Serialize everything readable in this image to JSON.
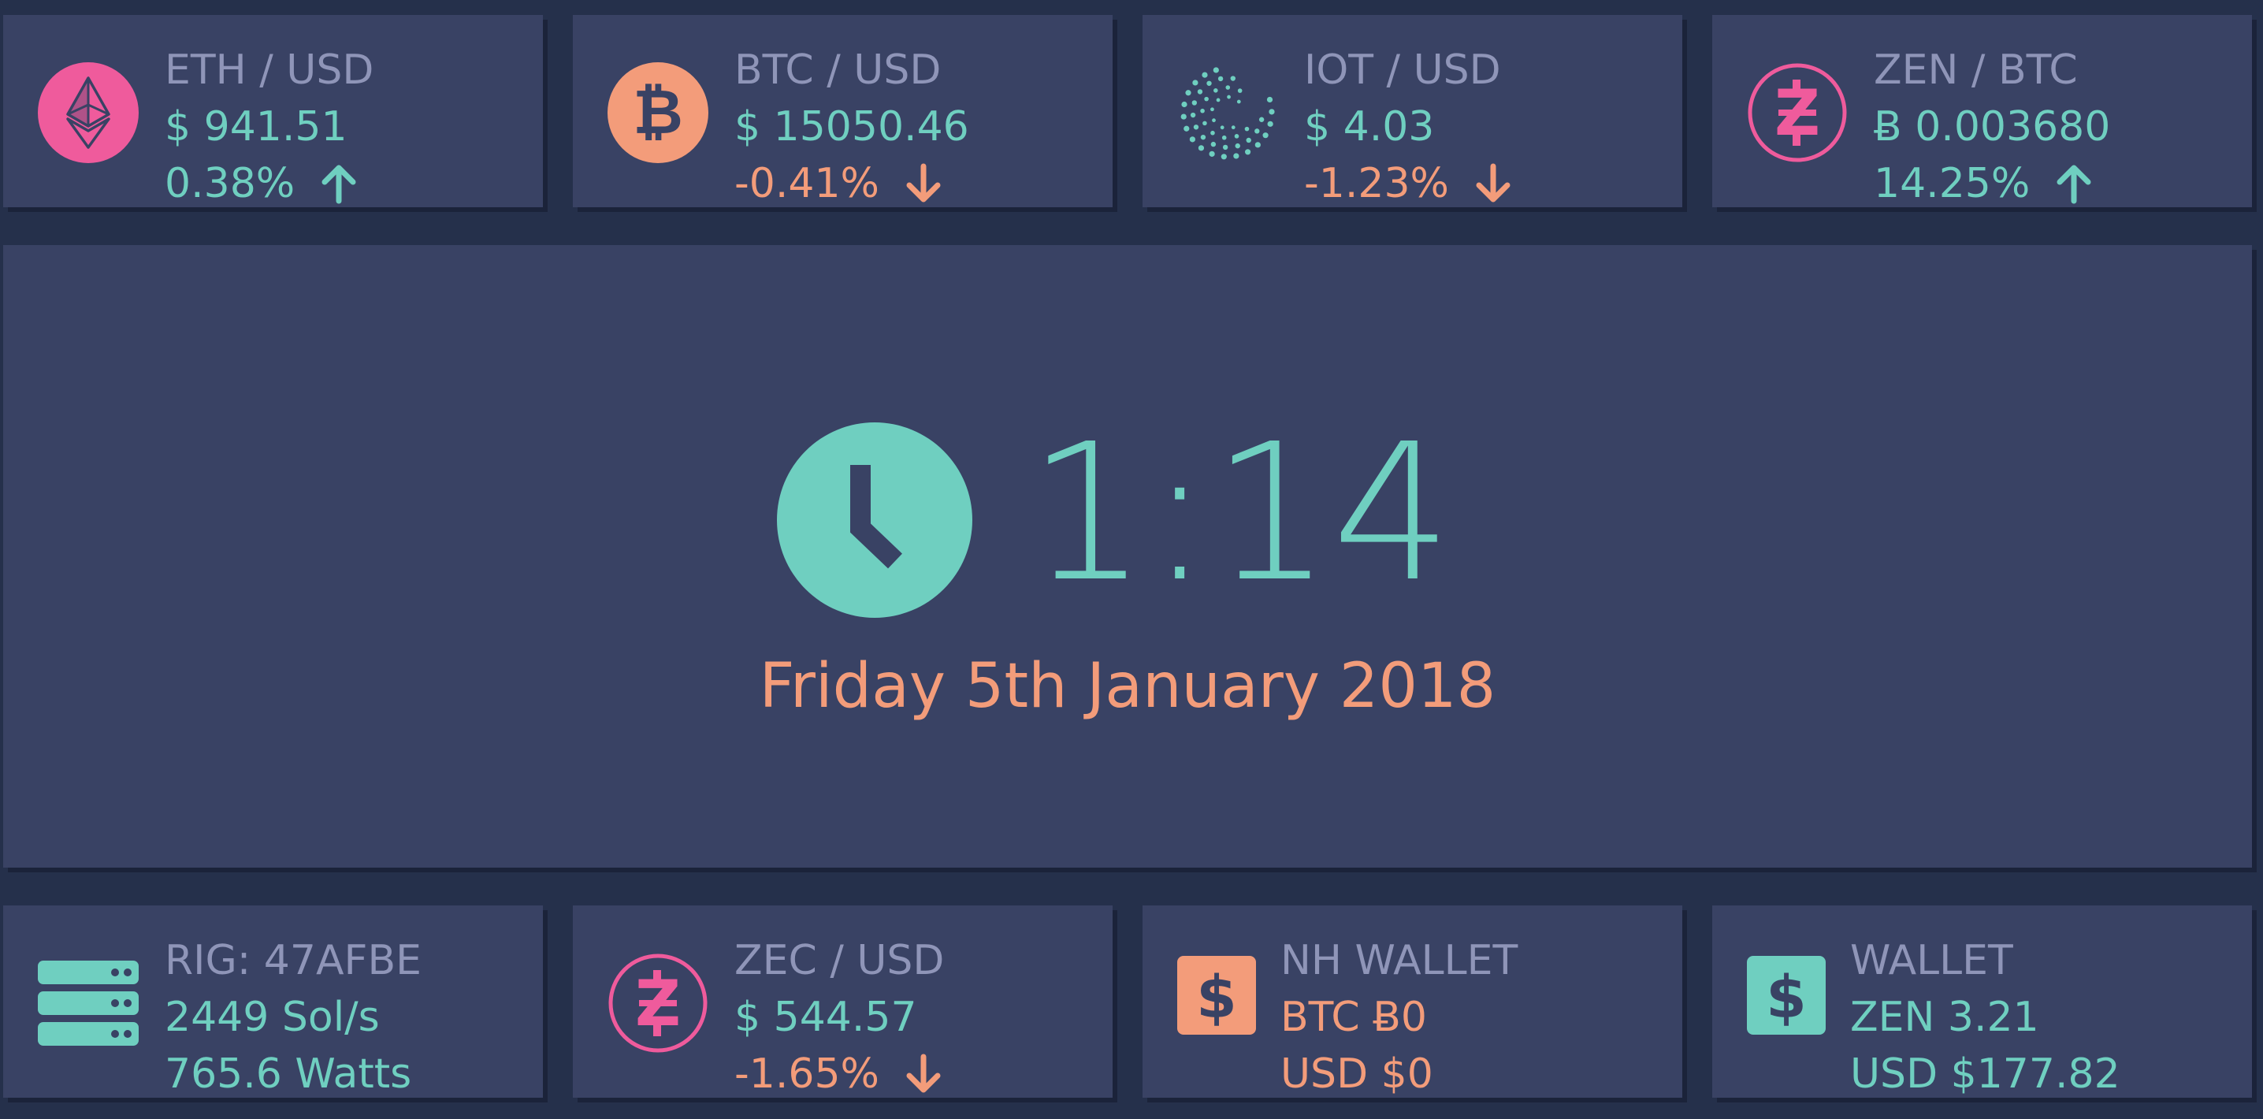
{
  "tickers": [
    {
      "pair": "ETH / USD",
      "price": "$ 941.51",
      "change": "0.38%",
      "trend": "up",
      "icon": "ethereum-icon"
    },
    {
      "pair": "BTC / USD",
      "price": "$ 15050.46",
      "change": "-0.41%",
      "trend": "down",
      "icon": "bitcoin-icon"
    },
    {
      "pair": "IOT / USD",
      "price": "$ 4.03",
      "change": "-1.23%",
      "trend": "down",
      "icon": "iota-icon"
    },
    {
      "pair": "ZEN / BTC",
      "price": "Ƀ 0.003680",
      "change": "14.25%",
      "trend": "up",
      "icon": "zencash-icon"
    }
  ],
  "clock": {
    "time": "1:14",
    "date": "Friday 5th January 2018",
    "icon": "clock-icon"
  },
  "rig": {
    "title": "RIG: 47AFBE",
    "hashrate": "2449 Sol/s",
    "power": "765.6 Watts",
    "icon": "server-icon"
  },
  "zec": {
    "pair": "ZEC / USD",
    "price": "$ 544.57",
    "change": "-1.65%",
    "trend": "down",
    "icon": "zcash-icon"
  },
  "nh_wallet": {
    "title": "NH WALLET",
    "btc": "BTC Ƀ0",
    "usd": "USD $0",
    "icon": "dollar-icon"
  },
  "wallet": {
    "title": "WALLET",
    "zen": "ZEN 3.21",
    "usd": "USD $177.82",
    "icon": "dollar-icon"
  },
  "colors": {
    "background": "#25304b",
    "card": "#394264",
    "teal": "#6fcfc0",
    "orange": "#f39c7a",
    "pink": "#ef5b9c",
    "muted": "#8f95b8"
  }
}
